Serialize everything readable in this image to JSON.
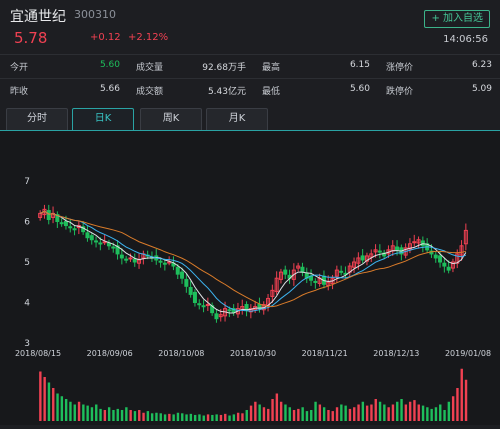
{
  "header": {
    "name": "宜通世纪",
    "code": "300310",
    "add_button": "+ 加入自选",
    "price": "5.78",
    "change": "+0.12",
    "change_pct": "+2.12%",
    "time": "14:06:56"
  },
  "stats": {
    "row1": [
      {
        "label": "今开",
        "value": "5.60"
      },
      {
        "label": "成交量",
        "value": "92.68万手"
      },
      {
        "label": "最高",
        "value": "6.15"
      },
      {
        "label": "涨停价",
        "value": "6.23"
      }
    ],
    "row2": [
      {
        "label": "昨收",
        "value": "5.66"
      },
      {
        "label": "成交额",
        "value": "5.43亿元"
      },
      {
        "label": "最低",
        "value": "5.60"
      },
      {
        "label": "跌停价",
        "value": "5.09"
      }
    ]
  },
  "tabs": [
    "分时",
    "日K",
    "周K",
    "月K"
  ],
  "active_tab": "日K",
  "colors": {
    "up": "#f04152",
    "down": "#1ebe5c",
    "accent": "#2aa3a4",
    "ma5": "#dfe2e6",
    "ma10": "#3db4f0",
    "ma20": "#d97b2a"
  },
  "chart_data": {
    "type": "candlestick",
    "ylim": [
      3,
      7
    ],
    "yticks": [
      "7",
      "6",
      "5",
      "4",
      "3"
    ],
    "xticks": [
      "2018/08/15",
      "2018/09/06",
      "2018/10/08",
      "2018/10/30",
      "2018/11/21",
      "2018/12/13",
      "2019/01/08"
    ],
    "closes": [
      6.2,
      6.3,
      6.05,
      6.2,
      6.0,
      5.95,
      5.9,
      5.85,
      5.8,
      5.9,
      5.75,
      5.6,
      5.55,
      5.5,
      5.45,
      5.5,
      5.4,
      5.35,
      5.2,
      5.1,
      5.05,
      5.1,
      5.0,
      5.05,
      5.2,
      5.15,
      5.1,
      5.05,
      5.0,
      4.95,
      5.0,
      4.9,
      4.7,
      4.6,
      4.4,
      4.2,
      4.0,
      3.95,
      3.9,
      3.95,
      3.75,
      3.6,
      3.7,
      3.85,
      3.8,
      3.75,
      3.85,
      3.9,
      3.8,
      3.85,
      3.9,
      3.85,
      3.95,
      4.1,
      4.3,
      4.6,
      4.75,
      4.7,
      4.6,
      4.8,
      4.9,
      4.75,
      4.6,
      4.55,
      4.5,
      4.6,
      4.45,
      4.5,
      4.6,
      4.8,
      4.75,
      4.7,
      4.9,
      5.0,
      5.1,
      5.05,
      5.15,
      5.2,
      5.3,
      5.25,
      5.15,
      5.3,
      5.4,
      5.3,
      5.2,
      5.35,
      5.45,
      5.5,
      5.55,
      5.4,
      5.3,
      5.2,
      5.1,
      5.0,
      4.9,
      4.8,
      5.0,
      5.2,
      5.4,
      5.78
    ],
    "volumes": [
      0.9,
      0.8,
      0.7,
      0.6,
      0.5,
      0.45,
      0.4,
      0.35,
      0.3,
      0.35,
      0.3,
      0.28,
      0.25,
      0.3,
      0.22,
      0.2,
      0.25,
      0.2,
      0.22,
      0.2,
      0.25,
      0.2,
      0.18,
      0.2,
      0.15,
      0.18,
      0.14,
      0.15,
      0.14,
      0.12,
      0.13,
      0.12,
      0.15,
      0.14,
      0.12,
      0.13,
      0.11,
      0.12,
      0.1,
      0.12,
      0.11,
      0.12,
      0.11,
      0.13,
      0.1,
      0.12,
      0.15,
      0.14,
      0.2,
      0.28,
      0.35,
      0.3,
      0.25,
      0.22,
      0.4,
      0.5,
      0.35,
      0.3,
      0.25,
      0.2,
      0.22,
      0.25,
      0.18,
      0.2,
      0.35,
      0.3,
      0.25,
      0.2,
      0.18,
      0.25,
      0.3,
      0.28,
      0.22,
      0.25,
      0.3,
      0.35,
      0.28,
      0.3,
      0.4,
      0.35,
      0.3,
      0.25,
      0.3,
      0.35,
      0.4,
      0.3,
      0.35,
      0.38,
      0.3,
      0.28,
      0.25,
      0.22,
      0.25,
      0.3,
      0.2,
      0.35,
      0.45,
      0.6,
      0.95,
      0.75
    ]
  }
}
